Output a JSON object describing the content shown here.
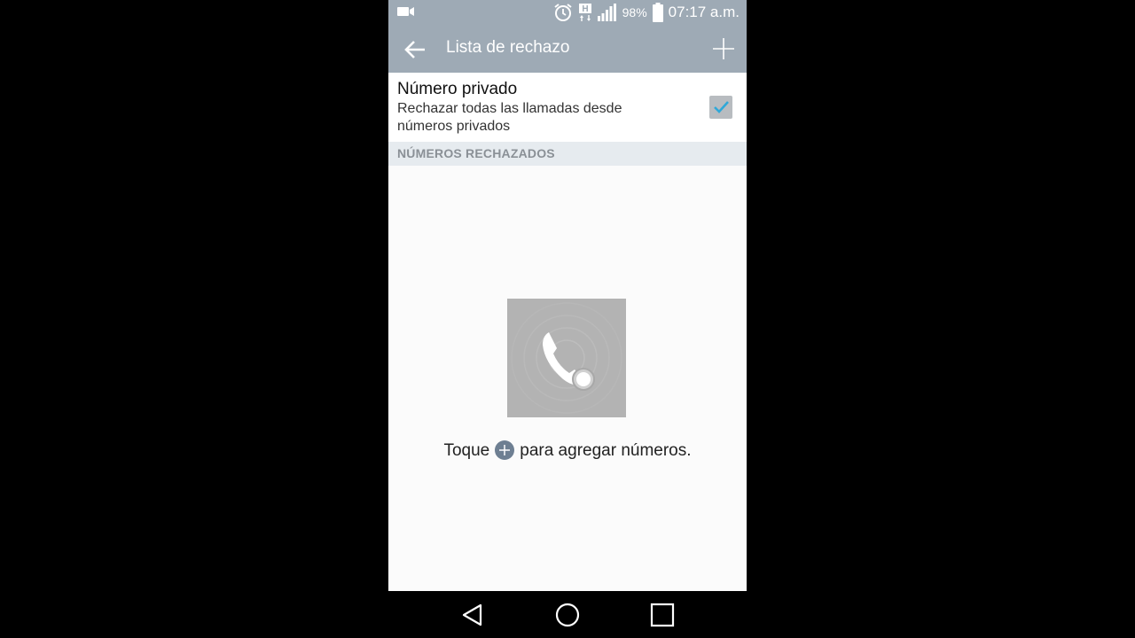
{
  "status_bar": {
    "battery_percent": "98%",
    "time": "07:17 a.m.",
    "network_type": "H",
    "icons": [
      "video-camera-icon",
      "alarm-icon",
      "network-h-icon",
      "signal-icon",
      "battery-icon"
    ]
  },
  "action_bar": {
    "title": "Lista de rechazo",
    "back_icon": "arrow-left-icon",
    "add_icon": "plus-icon"
  },
  "private_number": {
    "title": "Número privado",
    "summary": "Rechazar todas las llamadas desde números privados",
    "checked": true
  },
  "section": {
    "header": "NÚMEROS RECHAZADOS"
  },
  "empty_state": {
    "text_before": "Toque",
    "text_after": "para agregar números.",
    "icon": "blocked-call-icon"
  },
  "nav_bar": {
    "icons": [
      "back-triangle-icon",
      "home-circle-icon",
      "recents-square-icon"
    ]
  },
  "colors": {
    "action_bar": "#9eaab5",
    "accent_check": "#2fa8d8",
    "section_header_bg": "#e6ebef",
    "section_header_text": "#8a9096"
  }
}
